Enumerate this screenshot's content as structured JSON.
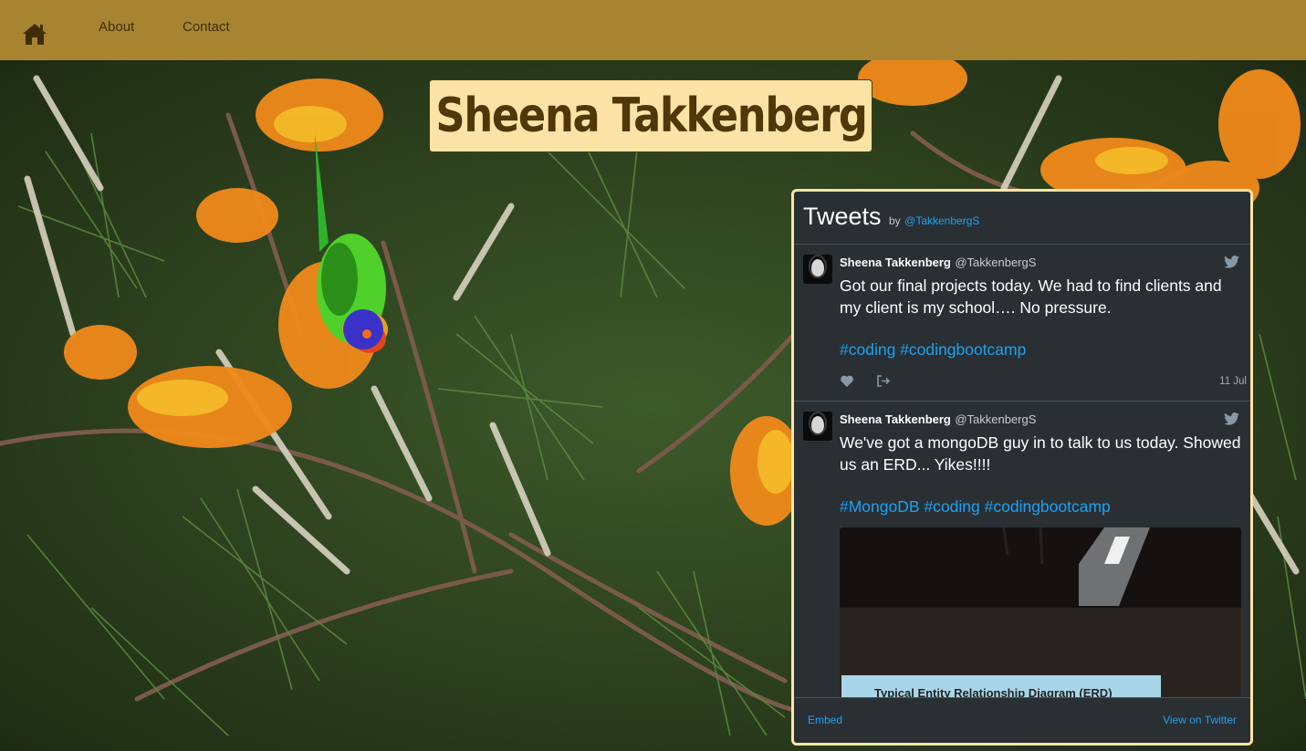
{
  "nav": {
    "about_label": "About",
    "contact_label": "Contact",
    "home_icon": "home-icon",
    "background_color": "#a88431"
  },
  "title": "Sheena Takkenberg",
  "widget": {
    "title": "Tweets",
    "by_label": "by",
    "handle": "@TakkenbergS",
    "tweets": [
      {
        "author": "Sheena Takkenberg",
        "handle": "@TakkenbergS",
        "text": "Got our final projects today. We had to find clients and my client is my school…. No pressure.",
        "hashtags": [
          "#coding",
          "#codingbootcamp"
        ],
        "date": "11 Jul"
      },
      {
        "author": "Sheena Takkenberg",
        "handle": "@TakkenbergS",
        "text": "We've got a mongoDB guy in to talk to us today. Showed us an ERD... Yikes!!!!",
        "hashtags": [
          "#MongoDB",
          "#coding",
          "#codingbootcamp"
        ],
        "media_caption": "Typical Entity Relationship Diagram (ERD)"
      }
    ],
    "embed_label": "Embed",
    "view_label": "View on Twitter"
  },
  "colors": {
    "title_bg": "#fde4a6",
    "title_text": "#4f3706",
    "widget_bg": "#292f33",
    "link_blue": "#1da1f2"
  }
}
